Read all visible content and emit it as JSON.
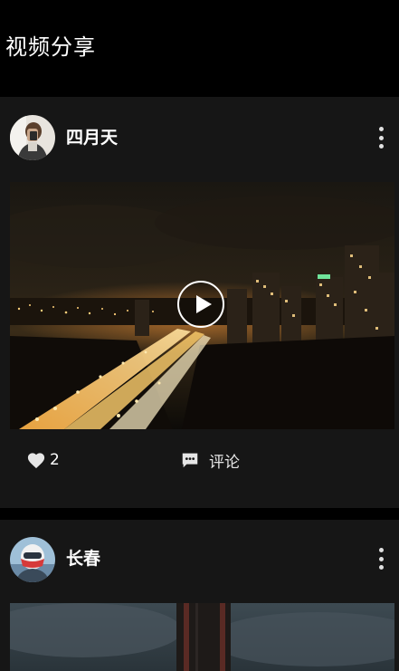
{
  "app": {
    "title": "视频分享"
  },
  "posts": [
    {
      "author": "四月天",
      "likes": "2",
      "comment_label": "评论"
    },
    {
      "author": "长春"
    }
  ],
  "colors": {
    "background": "#000000",
    "card": "#161616",
    "text": "#ffffff"
  },
  "icons": {
    "more": "more-vert-icon",
    "play": "play-icon",
    "like": "heart-icon",
    "comment": "comment-icon"
  }
}
